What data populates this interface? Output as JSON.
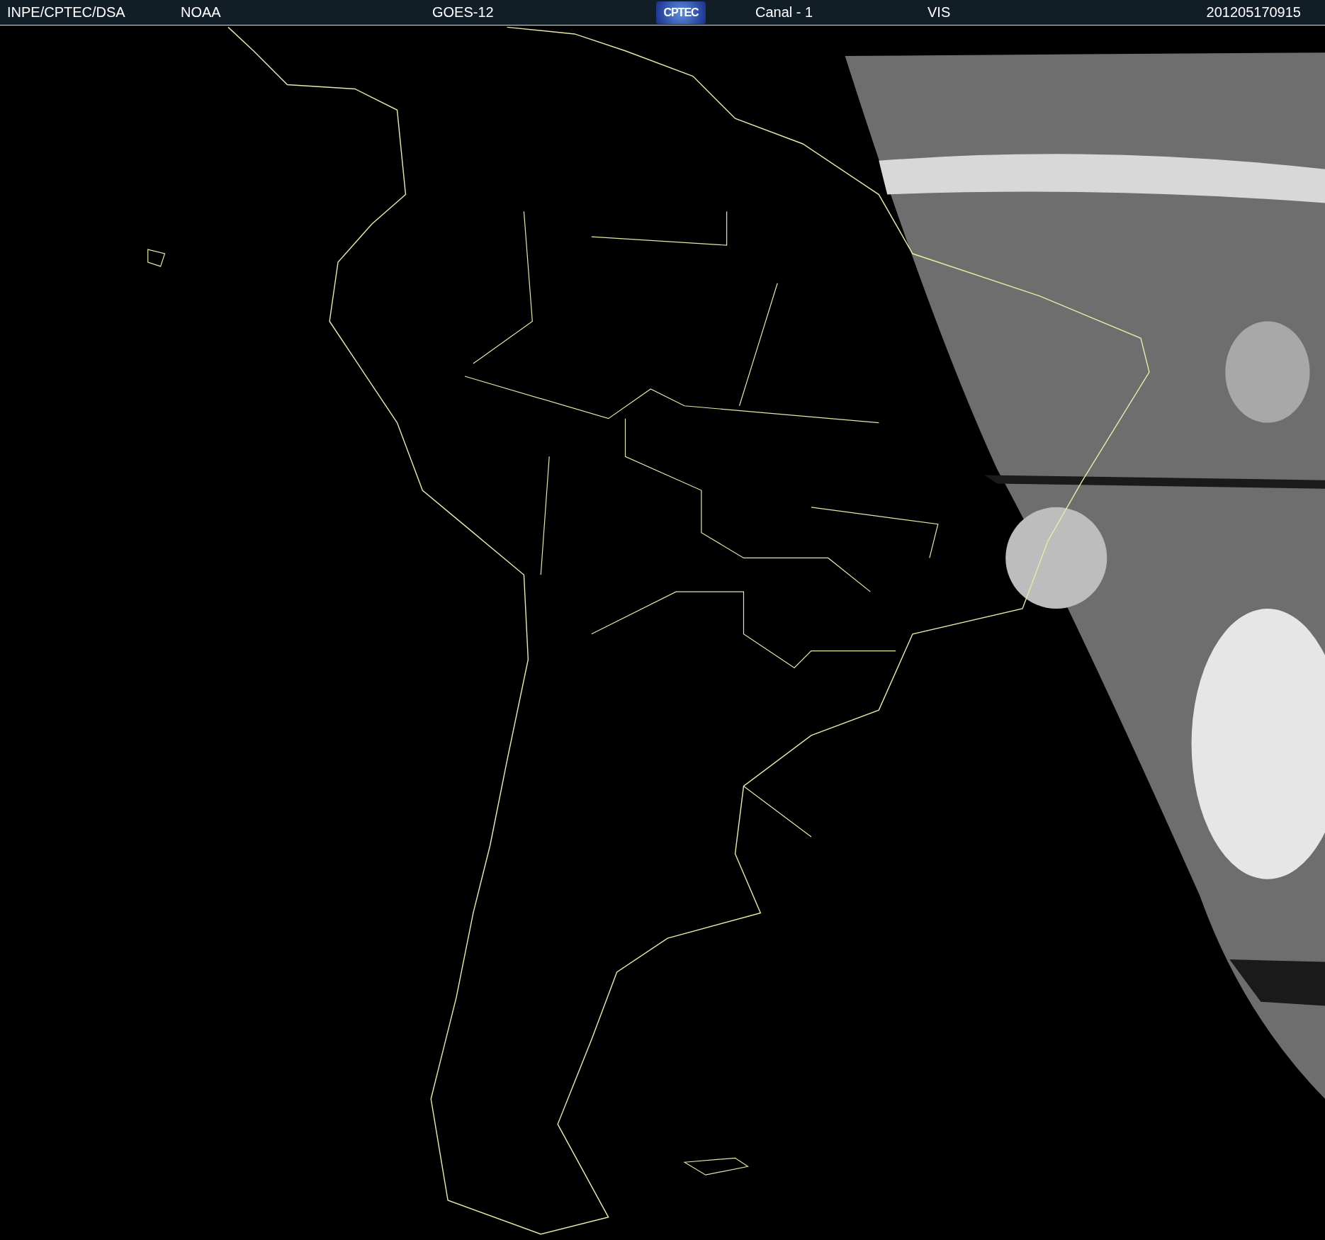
{
  "header": {
    "items": [
      {
        "kind": "text",
        "text": "INPE/CPTEC/DSA"
      },
      {
        "kind": "text",
        "text": "NOAA"
      },
      {
        "kind": "text",
        "text": "GOES-12"
      },
      {
        "kind": "logo",
        "text": "CPTEC"
      },
      {
        "kind": "text",
        "text": "Canal - 1"
      },
      {
        "kind": "text",
        "text": "VIS"
      },
      {
        "kind": "text",
        "text": "201205170915"
      }
    ]
  }
}
